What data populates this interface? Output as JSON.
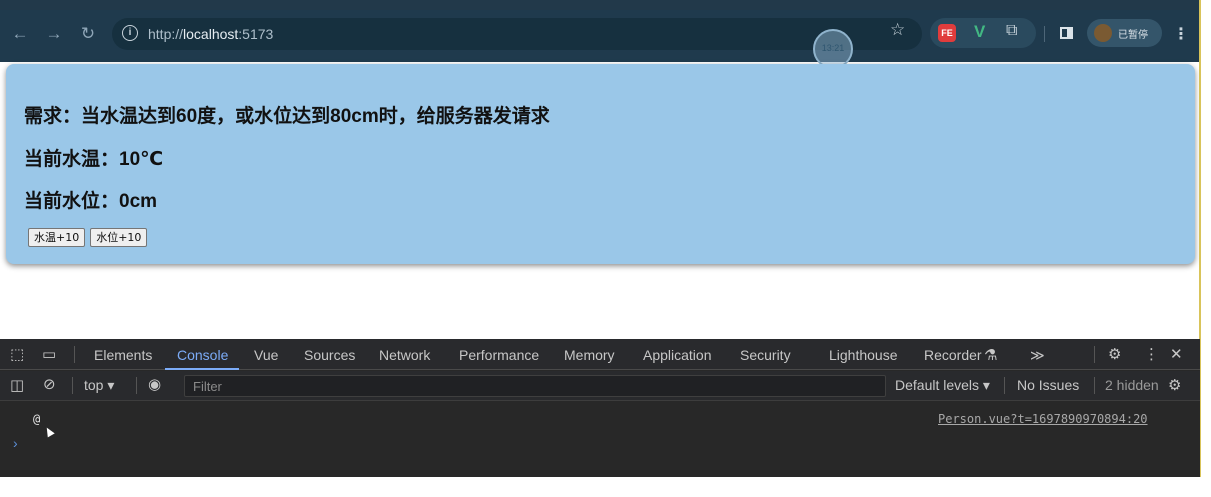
{
  "browser": {
    "url_scheme": "http://",
    "url_host": "localhost",
    "url_port": ":5173",
    "profile_label": "已暂停",
    "bubble_time": "13:21",
    "icons": {
      "back": "arrow-left-icon",
      "forward": "arrow-right-icon",
      "reload": "reload-icon",
      "info": "info-icon",
      "bookmark": "star-icon",
      "ext_fe": "FE",
      "ext_vue": "vue-devtools-icon",
      "ext_puzzle": "puzzle-icon",
      "more": "kebab-icon"
    }
  },
  "page": {
    "requirement": "需求：当水温达到60度，或水位达到80cm时，给服务器发请求",
    "temperature_line": "当前水温：10℃",
    "level_line": "当前水位：0cm",
    "buttons": {
      "temp_plus": "水温+10",
      "level_plus": "水位+10"
    }
  },
  "devtools": {
    "tabs": [
      "Elements",
      "Console",
      "Vue",
      "Sources",
      "Network",
      "Performance",
      "Memory",
      "Application",
      "Security",
      "Lighthouse",
      "Recorder"
    ],
    "active_tab": "Console",
    "more_tabs": "≫",
    "context": "top",
    "filter_placeholder": "Filter",
    "levels": "Default levels",
    "issues": "No Issues",
    "hidden": "2 hidden",
    "console": {
      "message": "@",
      "source": "Person.vue?t=1697890970894:20",
      "prompt": "›"
    }
  },
  "colors": {
    "card_bg": "#9ac7e8",
    "browser_bar": "#1f3a4d",
    "devtools_bg": "#282828",
    "active_tab": "#7cacf8"
  }
}
